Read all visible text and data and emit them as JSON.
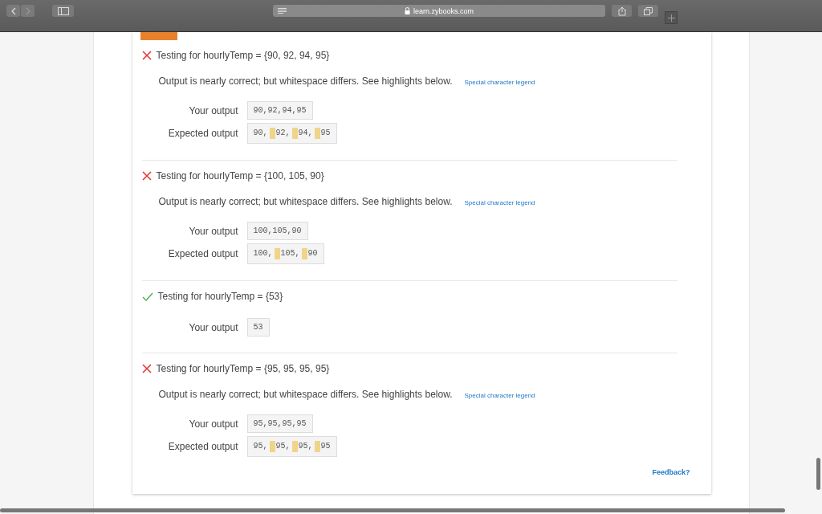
{
  "browser": {
    "address": "learn.zybooks.com"
  },
  "tests": [
    {
      "kind": "fail",
      "title": "Testing for hourlyTemp = {90, 92, 94, 95}",
      "message": "Output is nearly correct; but whitespace differs. See highlights below.",
      "legend_link": "Special character legend",
      "your_output_label": "Your output",
      "your_output": "90,92,94,95",
      "expected_label": "Expected output",
      "expected": [
        {
          "text": "90,",
          "space_highlighted": false
        },
        {
          "text": "92,",
          "space_highlighted": true
        },
        {
          "text": "94,",
          "space_highlighted": true
        },
        {
          "text": "95",
          "space_highlighted": true
        }
      ]
    },
    {
      "kind": "fail",
      "title": "Testing for hourlyTemp = {100, 105, 90}",
      "message": "Output is nearly correct; but whitespace differs. See highlights below.",
      "legend_link": "Special character legend",
      "your_output_label": "Your output",
      "your_output": "100,105,90",
      "expected_label": "Expected output",
      "expected": [
        {
          "text": "100,",
          "space_highlighted": false
        },
        {
          "text": "105,",
          "space_highlighted": true
        },
        {
          "text": "90",
          "space_highlighted": true
        }
      ]
    },
    {
      "kind": "pass",
      "title": "Testing for hourlyTemp = {53}",
      "your_output_label": "Your output",
      "your_output": "53"
    },
    {
      "kind": "fail",
      "title": "Testing for hourlyTemp = {95, 95, 95, 95}",
      "message": "Output is nearly correct; but whitespace differs. See highlights below.",
      "legend_link": "Special character legend",
      "your_output_label": "Your output",
      "your_output": "95,95,95,95",
      "expected_label": "Expected output",
      "expected": [
        {
          "text": "95,",
          "space_highlighted": false
        },
        {
          "text": "95,",
          "space_highlighted": true
        },
        {
          "text": "95,",
          "space_highlighted": true
        },
        {
          "text": "95",
          "space_highlighted": true
        }
      ]
    }
  ],
  "feedback_link": "Feedback?"
}
